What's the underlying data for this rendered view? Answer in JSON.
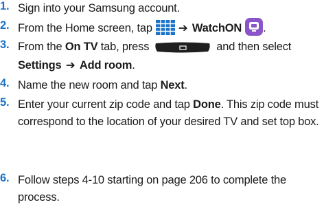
{
  "steps": [
    {
      "num": "1.",
      "text": "Sign into your Samsung account."
    },
    {
      "num": "2.",
      "pre": "From the Home screen, tap",
      "arrow": "➔",
      "app": "WatchON",
      "post": "."
    },
    {
      "num": "3.",
      "pre": "From the",
      "tab": "On TV",
      "mid": "tab, press",
      "post": "and then select",
      "menu_a": "Settings",
      "arrow": "➔",
      "menu_b": "Add room",
      "end": "."
    },
    {
      "num": "4.",
      "pre": "Name the new room and tap",
      "btn": "Next",
      "end": "."
    },
    {
      "num": "5.",
      "pre": "Enter your current zip code and tap",
      "btn": "Done",
      "post": ". This zip code must correspond to the location of your desired TV and set top box."
    },
    {
      "num": "6.",
      "text": "Follow steps 4-10 starting on page 206 to complete the process."
    }
  ],
  "icons": {
    "apps": "apps-grid-icon",
    "watchon": "watchon-icon",
    "menu": "menu-key-icon"
  },
  "colors": {
    "numbers": "#1a73c9",
    "apps_icon": "#1a73c9",
    "watchon_bg": "#8a55c8",
    "menu_key": "#1f1f1f"
  }
}
